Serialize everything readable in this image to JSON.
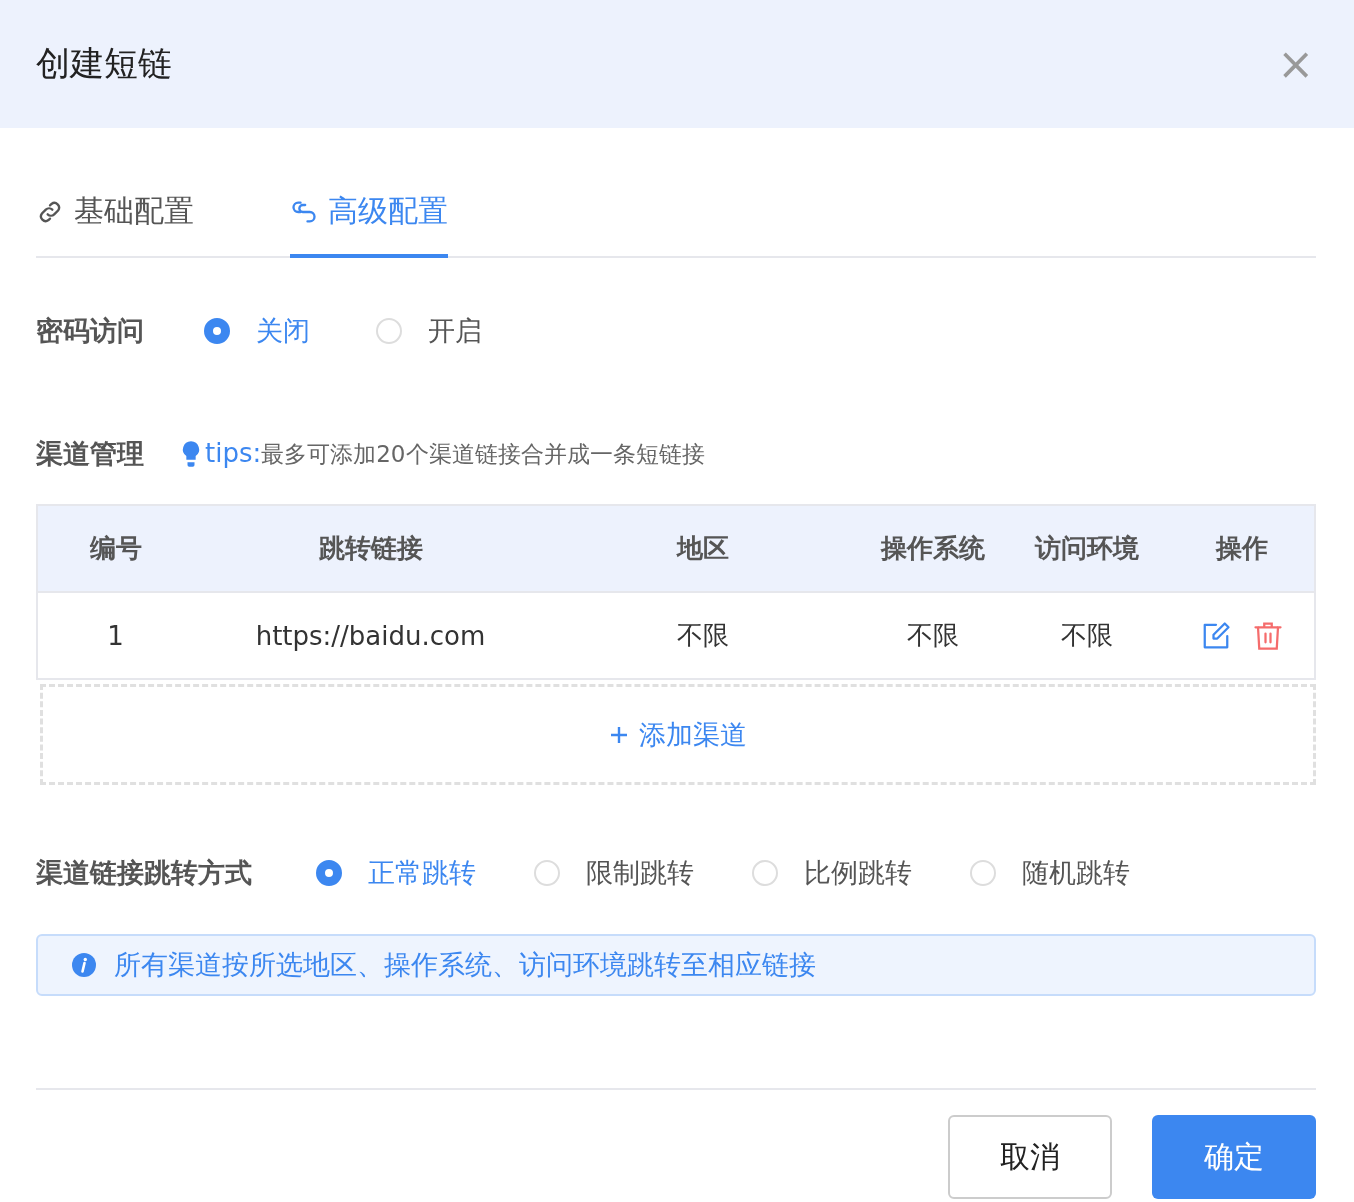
{
  "dialog": {
    "title": "创建短链",
    "close": "×"
  },
  "tabs": [
    {
      "label": "基础配置",
      "selected": false
    },
    {
      "label": "高级配置",
      "selected": true
    }
  ],
  "password_access": {
    "label": "密码访问",
    "options": [
      {
        "label": "关闭",
        "selected": true
      },
      {
        "label": "开启",
        "selected": false
      }
    ]
  },
  "channels": {
    "label": "渠道管理",
    "tip_prefix": "tips:",
    "tip": "最多可添加20个渠道链接合并成一条短链接",
    "columns": [
      "编号",
      "跳转链接",
      "地区",
      "操作系统",
      "访问环境",
      "操作"
    ],
    "rows": [
      {
        "cells": [
          "1",
          "https://baidu.com",
          "不限",
          "不限",
          "不限"
        ]
      }
    ],
    "add_button": "添加渠道"
  },
  "jump_mode": {
    "label": "渠道链接跳转方式",
    "options": [
      {
        "label": "正常跳转",
        "selected": true
      },
      {
        "label": "限制跳转",
        "selected": false
      },
      {
        "label": "比例跳转",
        "selected": false
      },
      {
        "label": "随机跳转",
        "selected": false
      }
    ],
    "info": "所有渠道按所选地区、操作系统、访问环境跳转至相应链接"
  },
  "buttons": [
    {
      "label": "取消",
      "kind": "default"
    },
    {
      "label": "确定",
      "kind": "primary"
    }
  ]
}
